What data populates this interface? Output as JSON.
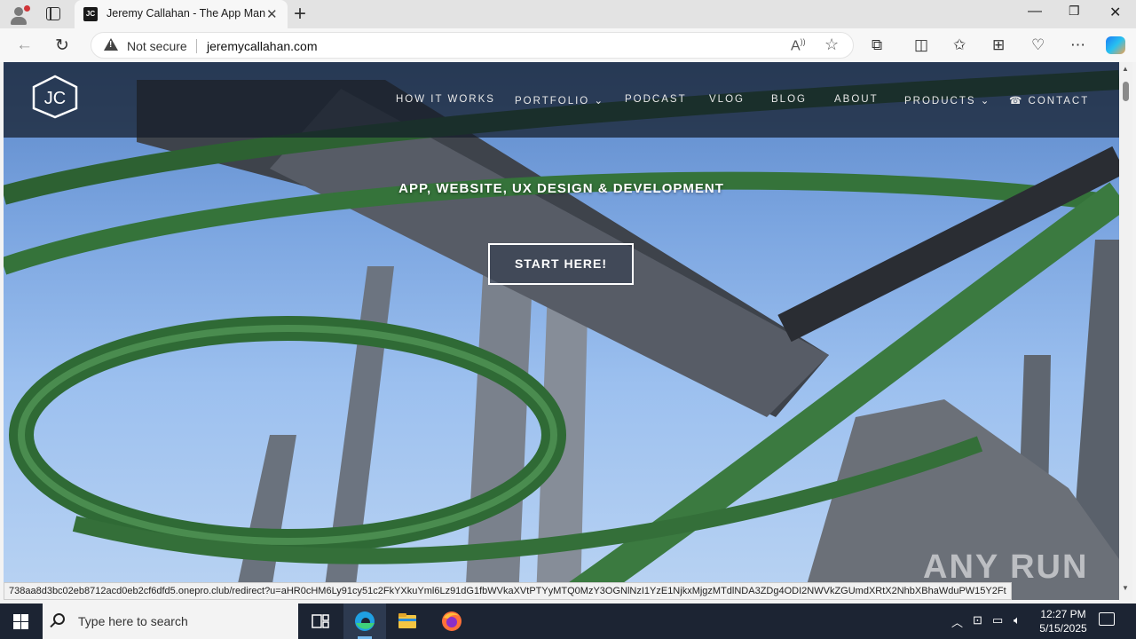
{
  "browser": {
    "tab_title": "Jeremy Callahan - The App Man",
    "tab_favicon_text": "JC",
    "security_label": "Not secure",
    "url": "jeremycallahan.com"
  },
  "site": {
    "logo_text": "JC",
    "nav": [
      {
        "label": "HOW IT WORKS"
      },
      {
        "label": "PORTFOLIO ⌄"
      },
      {
        "label": "PODCAST"
      },
      {
        "label": "VLOG"
      },
      {
        "label": "BLOG"
      },
      {
        "label": "ABOUT"
      },
      {
        "label": "PRODUCTS ⌄"
      },
      {
        "label": "☎ CONTACT"
      }
    ],
    "hero_title": "APP, WEBSITE, UX DESIGN & DEVELOPMENT",
    "cta_label": "START HERE!"
  },
  "status_bar_url": "738aa8d3bc02eb8712acd0eb2cf6dfd5.onepro.club/redirect?u=aHR0cHM6Ly91cy51c2FkYXkuYml6Lz91dG1fbWVkaXVtPTYyMTQ0MzY3OGNlNzI1YzE1NjkxMjgzMTdlNDA3ZDg4ODI2NWVkZGUmdXRtX2NhbXBhaWduPW15Y2Ft",
  "watermark": "ANY RUN",
  "taskbar": {
    "search_placeholder": "Type here to search",
    "time": "12:27 PM",
    "date": "5/15/2025"
  }
}
